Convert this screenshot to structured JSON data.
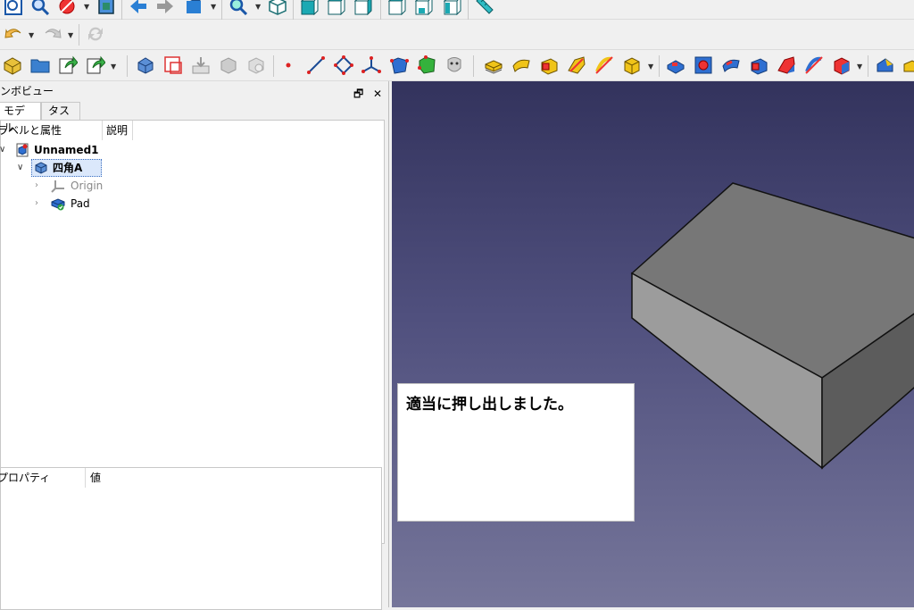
{
  "toolbar": {
    "row1_icons": [
      "zoom-fit-icon",
      "zoom-selection-icon",
      "draw-style-icon",
      "bounding-box-icon",
      "nav-back-icon",
      "nav-forward-icon",
      "macro-icon",
      "zoom-icon",
      "view-axonometric-icon",
      "view-front-icon",
      "view-top-icon",
      "view-right-icon",
      "view-rear-icon",
      "view-bottom-icon",
      "view-left-icon",
      "measure-icon"
    ],
    "row2_icons": [
      "undo-icon",
      "redo-icon",
      "refresh-icon"
    ],
    "row3_icons": [
      "part-icon",
      "open-icon",
      "export-icon",
      "share-icon",
      "body-icon",
      "create-sketch-icon",
      "import-icon",
      "shape-binder-icon",
      "clone-icon",
      "point-icon",
      "line-icon",
      "plane-icon",
      "local-cs-icon",
      "shape-face-icon",
      "sub-shape-icon",
      "face-icon",
      "pad-icon",
      "revolve-icon",
      "loft-icon",
      "pipe-icon",
      "helix-icon",
      "additive-box-icon",
      "pocket-icon",
      "hole-icon",
      "groove-icon",
      "subtractive-loft-icon",
      "subtractive-pipe-icon",
      "subtractive-helix-icon",
      "subtractive-box-icon",
      "fillet-icon",
      "chamfer-icon"
    ]
  },
  "combo": {
    "title": "コンボビュー",
    "restore_btn": "🗗",
    "close_btn": "✕",
    "tabs": [
      {
        "label": "モデル"
      },
      {
        "label": "タスク"
      }
    ],
    "tree_headers": {
      "label": "ラベルと属性",
      "description": "説明"
    },
    "tree": [
      {
        "label": "Unnamed1"
      },
      {
        "label": "四角A"
      },
      {
        "label": "Origin"
      },
      {
        "label": "Pad"
      }
    ],
    "prop_headers": {
      "property": "プロパティ",
      "value": "値"
    }
  },
  "view3d": {
    "caption": "適当に押し出しました。"
  },
  "colors": {
    "view_top": "#33335d",
    "view_bottom": "#76769a",
    "box_top": "#777777",
    "box_front": "#9c9c9c",
    "box_side": "#5c5c5c"
  }
}
